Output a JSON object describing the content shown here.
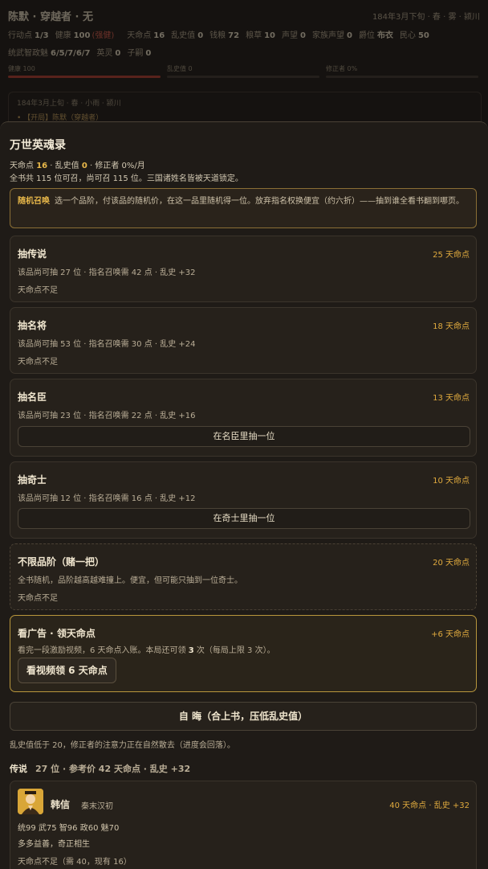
{
  "colors": {
    "accent_gold": "#e8b84a",
    "cost_gold": "#e0aa3e",
    "warn_red": "#e05a4a",
    "modal_bg": "#1f1b17",
    "page_bg": "#151210"
  },
  "background": {
    "title": "陈默 · 穿越者 · 无",
    "date": "184年3月下旬 · 春 · 雾 · 颍川",
    "row1": [
      {
        "label": "行动点",
        "value": "1/3"
      },
      {
        "label": "健康",
        "value": "100",
        "extra": "(强健)"
      },
      {
        "label": "天命点",
        "value": "16"
      },
      {
        "label": "乱史值",
        "value": "0"
      },
      {
        "label": "钱粮",
        "value": "72"
      },
      {
        "label": "粮草",
        "value": "10"
      },
      {
        "label": "声望",
        "value": "0"
      },
      {
        "label": "家族声望",
        "value": "0"
      },
      {
        "label": "爵位",
        "value": "布衣"
      },
      {
        "label": "民心",
        "value": "50"
      }
    ],
    "row2": [
      {
        "label": "统武智政魅",
        "value": "6/5/7/6/7"
      },
      {
        "label": "英灵",
        "value": "0"
      },
      {
        "label": "子嗣",
        "value": "0"
      }
    ],
    "bars": [
      {
        "label": "健康 100",
        "fill": 1.0
      },
      {
        "label": "乱史值 0",
        "fill": 0
      },
      {
        "label": "修正者 0%",
        "fill": 0
      }
    ],
    "log_date": "184年3月上旬 · 春 · 小雨 · 颍川",
    "log_line": "• 【开局】陈默（穿越者）"
  },
  "modal": {
    "title": "万世英魂录",
    "stat_line": {
      "tm_label": "天命点 ",
      "tm_value": "16",
      "lsz_label": " · 乱史值 ",
      "lsz_value": "0",
      "tail": " · 修正者 0%/月"
    },
    "summary": "全书共 115 位可召，尚可召 115 位。三国诸姓名皆被天道锁定。",
    "random_note": {
      "title": "随机召唤",
      "text": "选一个品阶，付该品的随机价，在这一品里随机得一位。放弃指名权换便宜（约六折）——抽到谁全看书翻到哪页。"
    },
    "tiers": [
      {
        "name": "抽传说",
        "cost": "25 天命点",
        "desc": "该品尚可抽 27 位 · 指名召唤需 42 点 · 乱史 +32",
        "status": "天命点不足",
        "button": ""
      },
      {
        "name": "抽名将",
        "cost": "18 天命点",
        "desc": "该品尚可抽 53 位 · 指名召唤需 30 点 · 乱史 +24",
        "status": "天命点不足",
        "button": ""
      },
      {
        "name": "抽名臣",
        "cost": "13 天命点",
        "desc": "该品尚可抽 23 位 · 指名召唤需 22 点 · 乱史 +16",
        "status": "",
        "button": "在名臣里抽一位"
      },
      {
        "name": "抽奇士",
        "cost": "10 天命点",
        "desc": "该品尚可抽 12 位 · 指名召唤需 16 点 · 乱史 +12",
        "status": "",
        "button": "在奇士里抽一位"
      },
      {
        "name": "不限品阶（赌一把）",
        "cost": "20 天命点",
        "desc": "全书随机，品阶越高越难撞上。便宜，但可能只抽到一位奇士。",
        "status": "天命点不足",
        "button": ""
      }
    ],
    "ad": {
      "name": "看广告 · 领天命点",
      "reward": "+6 天命点",
      "desc_a": "看完一段激励视频，6 天命点入账。本局还可领 ",
      "desc_count": "3",
      "desc_b": " 次（每局上限 3 次）。",
      "button": "看视频领 6 天命点"
    },
    "ziwei_button": "自 晦（合上书，压低乱史值）",
    "chaos_note": "乱史值低于 20，修正者的注意力正在自然散去（进度会回落）。",
    "section": {
      "title": "传说",
      "sub": "27 位 · 参考价 42 天命点 · 乱史 +32"
    },
    "hero": {
      "name": "韩信",
      "era": "秦末汉初",
      "cost": "40 天命点 · 乱史 +32",
      "stats": "统99 武75 智96 政60 魅70",
      "quote": "多多益善，奇正相生",
      "status": "天命点不足（需 40，现有 16）"
    }
  }
}
